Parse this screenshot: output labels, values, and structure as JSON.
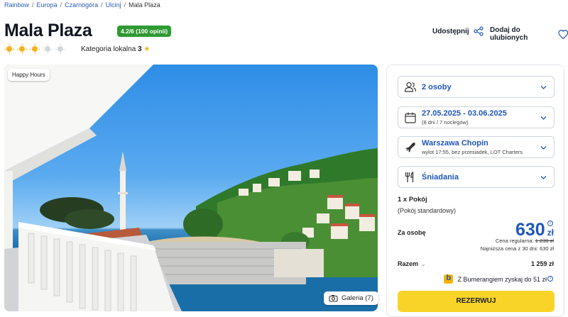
{
  "breadcrumb": [
    "Rainbow",
    "Europa",
    "Czarnogóra",
    "Ulcinj",
    "Mala Plaza"
  ],
  "hotel": {
    "name": "Mala Plaza",
    "rating": "4.2/6 (100 opinii)",
    "stars_on": 3,
    "stars_total": 5,
    "category_label": "Kategoria lokalna",
    "category_value": "3"
  },
  "actions": {
    "share": "Udostępnij",
    "favorite": "Dodaj do ulubionych"
  },
  "photo": {
    "badge": "Happy Hours",
    "gallery": "Galeria (7)"
  },
  "booking": {
    "guests": "2 osoby",
    "dates": "27.05.2025 - 03.06.2025",
    "dates_sub": "(8 dni / 7 noclegów)",
    "departure": "Warszawa Chopin",
    "departure_sub": "wylot 17:55, bez przesiadek, LOT Charters",
    "board": "Śniadania",
    "room": "1 x Pokój",
    "room_type": "(Pokój standardowy)",
    "per_person_label": "Za osobę",
    "price": "630",
    "currency": "zł",
    "regular_label": "Cena regularna:",
    "regular_price": "1 230 zł",
    "lowest": "Najniższa cena z 30 dni: 630 zł",
    "total_label": "Razem",
    "total": "1 259 zł",
    "bumerang": "Z Bumerangiem zyskaj do 51 zł",
    "reserve": "REZERWUJ"
  },
  "colors": {
    "accent": "#1f57b8",
    "badge_green": "#2e9a32",
    "reserve_yellow": "#f9d428",
    "sun": "#f3b21a"
  }
}
